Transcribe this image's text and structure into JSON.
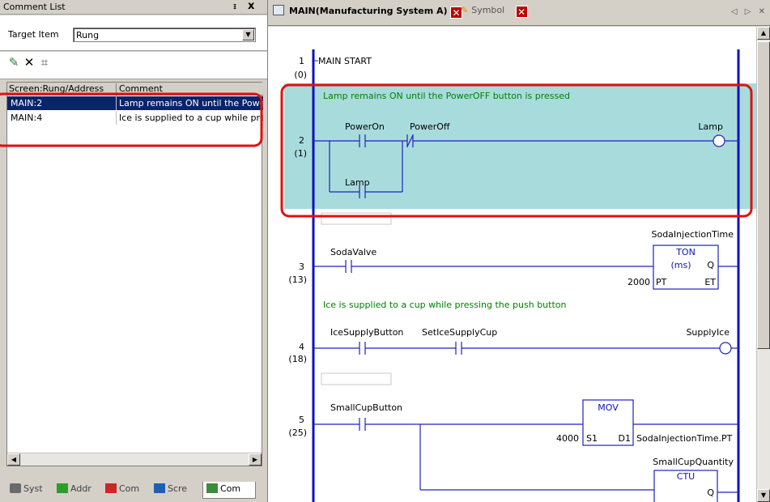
{
  "comment_list": {
    "title": "Comment List",
    "pin_icon": "pin-icon",
    "close_label": "x",
    "target_item_label": "Target Item",
    "target_item_value": "Rung",
    "columns": [
      "Screen:Rung/Address",
      "Comment"
    ],
    "rows": [
      {
        "address": "MAIN:2",
        "comment": "Lamp remains ON until the  PowerOFF button is pressed",
        "selected": true
      },
      {
        "address": "MAIN:4",
        "comment": "Ice is supplied to a cup while pressing the push button",
        "selected": false
      }
    ],
    "bottom_tabs": [
      {
        "label": "Syst",
        "icon": "system-icon"
      },
      {
        "label": "Addr",
        "icon": "address-icon"
      },
      {
        "label": "Com",
        "icon": "common-icon"
      },
      {
        "label": "Scre",
        "icon": "screen-icon"
      },
      {
        "label": "Com",
        "icon": "comment-icon",
        "active": true
      }
    ]
  },
  "editor": {
    "tabs": [
      {
        "label": "MAIN(Manufacturing System A)",
        "active": true
      },
      {
        "label": "Symbol",
        "active": false
      }
    ],
    "rungs": [
      {
        "number": "1",
        "step": "(0)",
        "text": "MAIN START"
      },
      {
        "number": "2",
        "step": "(1)",
        "comment": "Lamp remains ON until the  PowerOFF button is pressed",
        "contacts": [
          "PowerOn",
          "PowerOff",
          "Lamp"
        ],
        "coil": "Lamp"
      },
      {
        "number": "3",
        "step": "(13)",
        "contacts": [
          "SodaValve"
        ],
        "instruction": {
          "name": "TON",
          "unit": "(ms)",
          "label": "SodaInjectionTime",
          "pt": "2000",
          "pins": [
            "PT",
            "ET",
            "Q"
          ]
        }
      },
      {
        "number": "4",
        "step": "(18)",
        "comment": "Ice is supplied to a cup while pressing the push button",
        "contacts": [
          "IceSupplyButton",
          "SetIceSupplyCup"
        ],
        "coil": "SupplyIce"
      },
      {
        "number": "5",
        "step": "(25)",
        "contacts": [
          "SmallCupButton"
        ],
        "instruction": {
          "name": "MOV",
          "s1": "4000",
          "d1": "SodaInjectionTime.PT",
          "pins": [
            "S1",
            "D1"
          ]
        },
        "instruction2": {
          "name": "CTU",
          "label": "SmallCupQuantity",
          "pins": [
            "Q"
          ]
        }
      }
    ]
  },
  "colors": {
    "rail": "#1010c0",
    "wire": "#2020c0",
    "comment_text": "#008000",
    "highlight_fill": "#a8dcdc",
    "annotation": "#e01010",
    "selection": "#0a246a"
  }
}
